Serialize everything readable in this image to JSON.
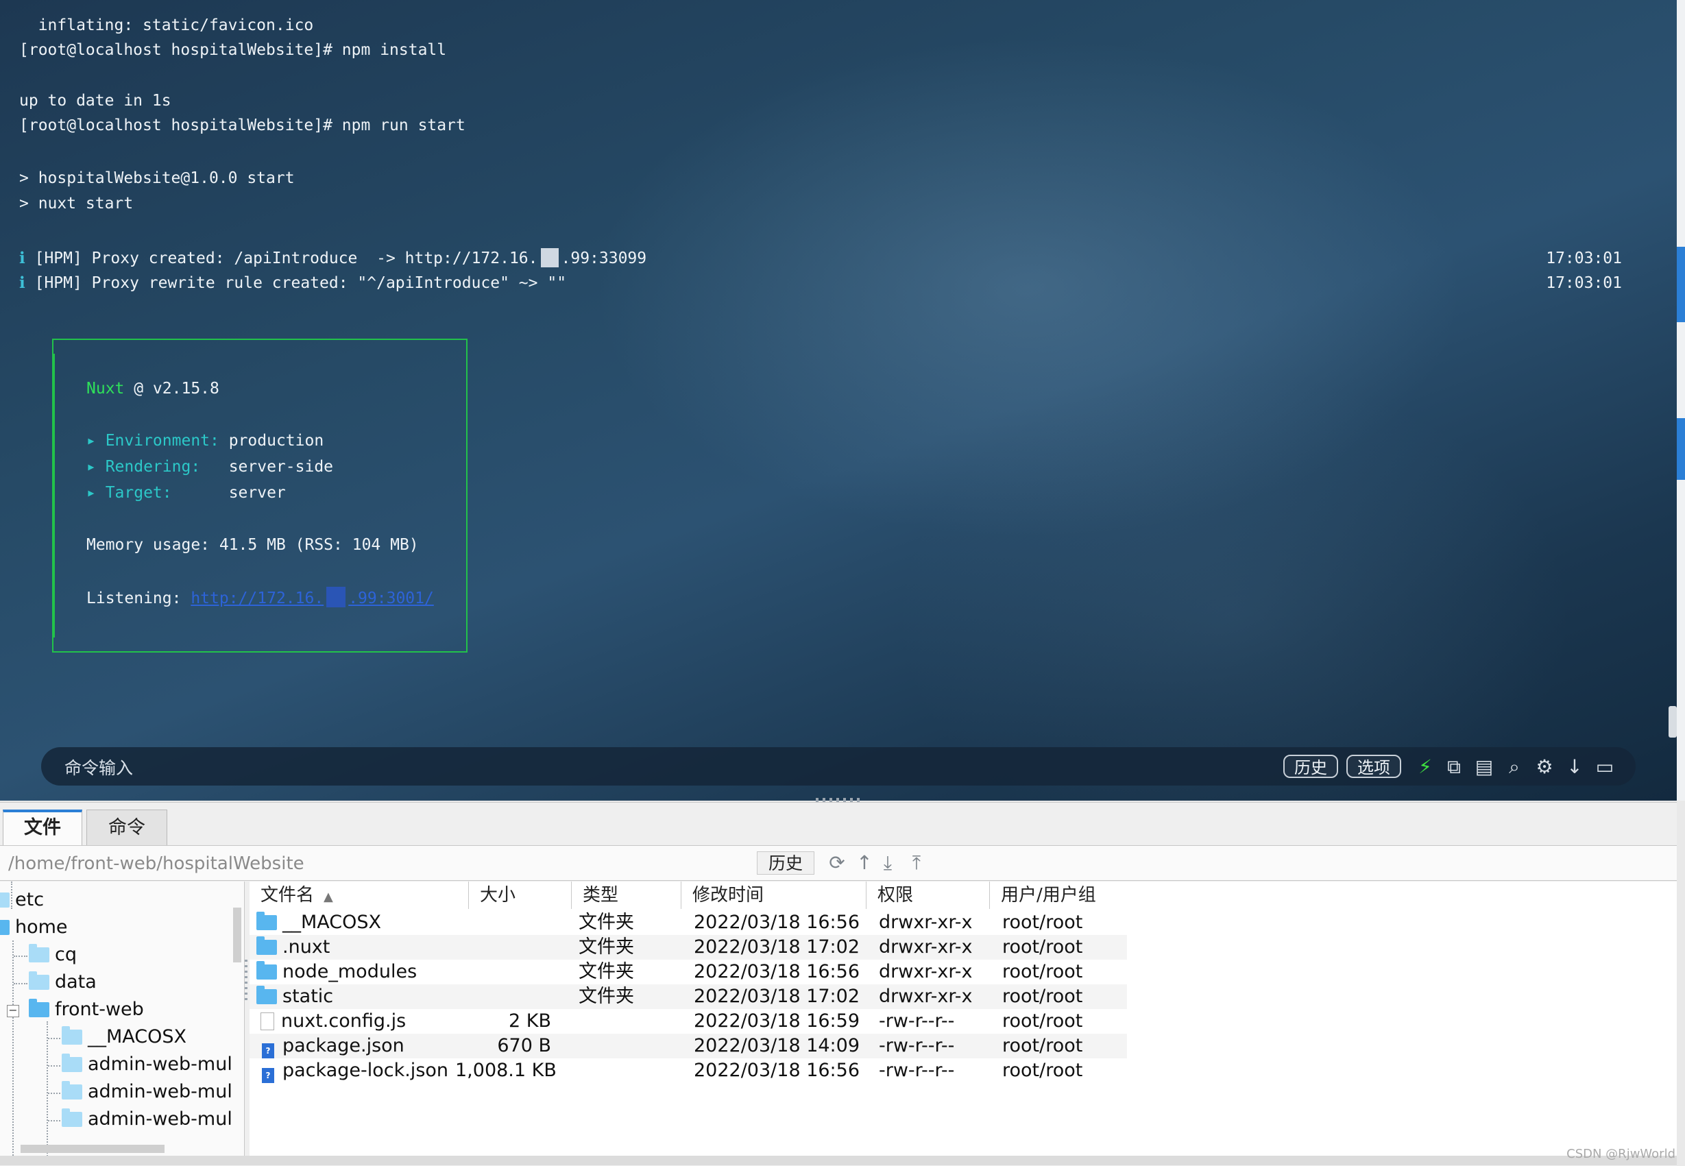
{
  "terminal": {
    "lines": [
      "  inflating: static/favicon.ico",
      "[root@localhost hospitalWebsite]# npm install",
      "up to date in 1s",
      "[root@localhost hospitalWebsite]# npm run start",
      "> hospitalWebsite@1.0.0 start",
      "> nuxt start"
    ],
    "proxy1": {
      "icon": "ℹ",
      "text_a": " [HPM] Proxy created: /apiIntroduce  -> http://172.16.",
      "text_b": ".99:33099",
      "time": "17:03:01"
    },
    "proxy2": {
      "icon": "ℹ",
      "text": " [HPM] Proxy rewrite rule created: \"^/apiIntroduce\" ~> \"\"",
      "time": "17:03:01"
    },
    "nuxt_box": {
      "name": "Nuxt",
      "version": " @ v2.15.8",
      "env_label": "▸ Environment:",
      "env_value": " production",
      "render_label": "▸ Rendering:",
      "render_value": "   server-side",
      "target_label": "▸ Target:",
      "target_value": "      server",
      "memory": "Memory usage: 41.5 MB (RSS: 104 MB)",
      "listening_label": "Listening: ",
      "listening_a": "http://172.16.",
      "listening_b": ".99:3001/"
    },
    "command_bar": {
      "placeholder": "命令输入",
      "history_label": "历史",
      "options_label": "选项"
    }
  },
  "file_panel": {
    "tabs": [
      {
        "label": "文件"
      },
      {
        "label": "命令"
      }
    ],
    "path": "/home/front-web/hospitalWebsite",
    "history_button": "历史",
    "tree": [
      {
        "label": "etc"
      },
      {
        "label": "home"
      },
      {
        "label": "cq"
      },
      {
        "label": "data"
      },
      {
        "label": "front-web"
      },
      {
        "label": "__MACOSX"
      },
      {
        "label": "admin-web-mul"
      },
      {
        "label": "admin-web-mul"
      },
      {
        "label": "admin-web-mul"
      }
    ],
    "columns": {
      "name": "文件名",
      "size": "大小",
      "type": "类型",
      "modified": "修改时间",
      "perm": "权限",
      "owner": "用户/用户组"
    },
    "rows": [
      {
        "name": "__MACOSX",
        "size": "",
        "type": "文件夹",
        "modified": "2022/03/18 16:56",
        "perm": "drwxr-xr-x",
        "owner": "root/root"
      },
      {
        "name": ".nuxt",
        "size": "",
        "type": "文件夹",
        "modified": "2022/03/18 17:02",
        "perm": "drwxr-xr-x",
        "owner": "root/root"
      },
      {
        "name": "node_modules",
        "size": "",
        "type": "文件夹",
        "modified": "2022/03/18 16:56",
        "perm": "drwxr-xr-x",
        "owner": "root/root"
      },
      {
        "name": "static",
        "size": "",
        "type": "文件夹",
        "modified": "2022/03/18 17:02",
        "perm": "drwxr-xr-x",
        "owner": "root/root"
      },
      {
        "name": "nuxt.config.js",
        "size": "2 KB",
        "type": "",
        "modified": "2022/03/18 16:59",
        "perm": "-rw-r--r--",
        "owner": "root/root"
      },
      {
        "name": "package.json",
        "size": "670 B",
        "type": "",
        "modified": "2022/03/18 14:09",
        "perm": "-rw-r--r--",
        "owner": "root/root"
      },
      {
        "name": "package-lock.json",
        "size": "1,008.1 KB",
        "type": "",
        "modified": "2022/03/18 16:56",
        "perm": "-rw-r--r--",
        "owner": "root/root"
      }
    ],
    "watermark": "CSDN @RjwWorld"
  },
  "colors": {
    "terminal_bg": "#264a66",
    "nuxt_green": "#2fe05a",
    "label_cyan": "#2cc8c8",
    "folder_blue": "#58b6ef",
    "tab_accent": "#2b7fd6"
  }
}
